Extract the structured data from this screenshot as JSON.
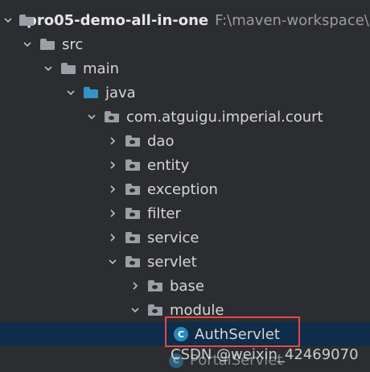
{
  "tree": {
    "project": {
      "label": "pro05-demo-all-in-one",
      "path": "F:\\maven-workspace\\s"
    },
    "src": "src",
    "main": "main",
    "java": "java",
    "package": "com.atguigu.imperial.court",
    "subpackages": [
      "dao",
      "entity",
      "exception",
      "filter",
      "service",
      "servlet"
    ],
    "servlet_children": [
      "base",
      "module"
    ],
    "selected_class": "AuthServlet",
    "class_icon_letter": "C",
    "partial_class": "PortalServlet"
  },
  "watermark": "CSDN @weixin_42469070",
  "colors": {
    "selection": "#0d2d4a",
    "highlight_border": "#e24848",
    "class_icon": "#2a8ab8",
    "source_folder": "#3592c4"
  }
}
